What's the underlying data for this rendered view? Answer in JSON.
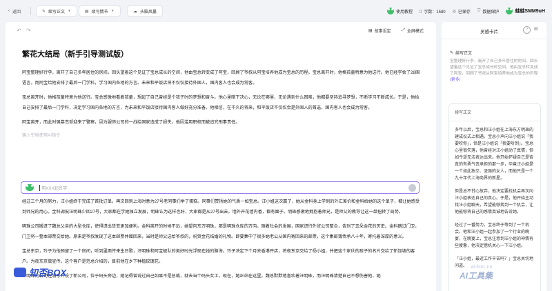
{
  "topbar": {
    "back": "返回",
    "mode": "续写正文",
    "plot": "续写情节",
    "style": "头脑风暴",
    "tutorial": "使用教程",
    "word_count": "字数：1580",
    "saved": "已保存",
    "privacy": "数据保护",
    "username": "蛙蛙SMM9uH"
  },
  "editor": {
    "story_settings": "故事设定",
    "fullscreen": "全屏模式",
    "title": "繁花大结局（新手引导测试版）",
    "paragraphs": [
      "阿宝整理好行李，离开了自己多年居住的房间。回头望着这个见证了宝总成长的空间，他由宝总转变成了阿宝，回顾了爷叔从阿宝培养他成为宝总的历程。宝总离开时，他格孩童特意为他送行。他已经学会了28国语言，而阿宝给他安排了最后一门学料，学习国内各地的方言。未来和平饭店将不仅仅接待外国人，国内客人也会成为常客。",
      "宝总离开时，他格孩童特意为他送行。宝总感激地看着孩童，想起了自己曾经是个孩子时的梦想和奋斗。他心里暗下决心，无论在哪里，无论遇到什么困难，他都要坚持追寻梦想，不断学习不断成长。于是，他给自己安排了最后一门学料，决定学习国内各地的方言，为未来和平饭店接待国内客人做好充分准备。他相信，在不久的将来，和平饭店不仅仅会是外国人的首选，国内客人也会成为常客。",
      "阿宝离开，而此时强慕杰却迎来了警察，因为服饰公司的一战给国家造成了损失，他因滥用职权而被追究刑事责任。"
    ],
    "placeholder_hint": "输入空格使用AI指令",
    "cmd_placeholder": "用XXX起名字",
    "after_paragraphs": [
      "经过三个月的努力，汪小姐终于完成了首批订单。再次回到上海时意为27号老同事们举了蛋糕。同事们赞扬她的气质一如宝总。汪小姐这次赢了，她从金科身上学到的外汇差价和金科给她的这个单子，都让她感受到师兄的用心。金科调侃汪明珠少回27号，大家都在学她独立发展，明珠认为这样也好，大家都是从27号出去，墙外开花墙内香，都有面子。明珠感激地拥抱着师兄，是师父的教导让这一单扭转了局势。",
      "明珠公司搬进了魏总父亲的大型仓库，使得进出货变更加便利。金科离开的时候不远，她望向东方明珠，那是明珠仓库的方向。随着社会的发展，国家进行外贸公司整合，告别了五朵金花的历史。金科踏过门卫，门卫将一整本邮票交给她。原来是爷叔发现了这本邮票并赠回来，当时是师父送给爷叔的，祝贺金花结婚的礼物。即要集中了很多她老公从国内寄回来的邮票，这个集邮簿传承八十年，寄托着深厚的意义。",
      "宝总东京，玲子为他预留了一个房间，听到里面传来生日歌，汪明珠和阿宝舰队的美好时光浮现在她的脑海。玲子决定下个月去香港开店，将夜东京交给了杨小姐，并把这个家伙的孩子的名片交给了新加坡的客户。为夜东京做宣传。这个客户是范总介绍的，目前他在乡下种植玫瑰花。",
      "汪明珠的公司在浦东开设了新公司，位于码头旁边，她记得曾说过自己如果不是总裁，就去当个码头女工。现在，她正站在这里。魏总默默地喜欢着汪明珠，而汪明珠清楚自己不想伤害他，她"
    ]
  },
  "right_panel": {
    "title": "灵感卡片",
    "help": "?",
    "card1": {
      "heading": "续写正文",
      "text": "宝整理好行李，离开了自己多年居住的房间。回头望着这个见证了宝总成长的空间，他由宝总转变成了阿宝，回顾了爷叔从阿宝培养他成为宝总的历程",
      "more": "(更多)"
    },
    "card2": {
      "heading": "续写正文",
      "paragraphs": [
        "多年以后，宝总和汪小姐在上海东方明珠的建成仪式上相遇。宝总小声向汪小姐说「我要吹你」，但是汪小姐说「我要听到」。宝总心里很失落，他曾经对汪小姐动了真情，但如今却无法表达出来。他开始怀疑自己是否真的有勇气去承担的那一步，毕竟汪小姐是一个如此独立、坚强的女人，而他只是一个九十年代上海商界的新星。",
        "但是总不甘心放弃，他决定要找机会再次向汪小姐表达自己的真心。于是，他开始主动找汪小姐聊天，希望能够找到一个机会，让他能够将自己的感情真诚地告诉她。",
        "经过了一番努力，宝总终于等到了一个机会。他和汪小姐一起参加了一个行业的晚宴，在晚宴上，宝总注意到汪小姐的神情有些疲惫，他决定借机关心一下汪小姐。",
        "「汪小姐，最近工作辛苦吗？」宝总关切地问道。"
      ]
    }
  },
  "watermarks": {
    "left": "知否BOX",
    "right_small": "ai-bot.cn",
    "right_big": "AI工具集"
  },
  "colors": {
    "accent": "#6b5cf0",
    "command_border": "#9a7cf0",
    "frog_green": "#3fbf6a"
  },
  "icons": {
    "back": "chevron-left-icon",
    "mode": "pen-icon",
    "plot": "book-icon",
    "style": "cloud-icon",
    "tutorial": "frog-icon",
    "word_count": "doc-icon",
    "saved": "check-circle-icon",
    "privacy": "shield-icon"
  }
}
